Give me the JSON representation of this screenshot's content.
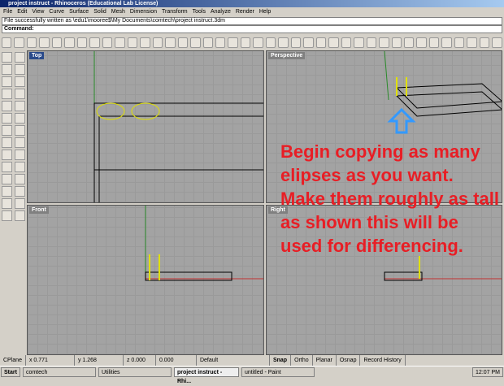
{
  "window": {
    "title": "project instruct - Rhinoceros (Educational Lab License)"
  },
  "menu": [
    "File",
    "Edit",
    "View",
    "Curve",
    "Surface",
    "Solid",
    "Mesh",
    "Dimension",
    "Transform",
    "Tools",
    "Analyze",
    "Render",
    "Help"
  ],
  "command_history": "File successfully written as \\edu1\\mooree$\\My Documents\\comtech\\project instruct.3dm",
  "command_prompt": "Command:",
  "viewports": [
    "Top",
    "Perspective",
    "Front",
    "Right"
  ],
  "annotation": "Begin copying as many elipses as you want.  Make them roughly as tall as shown this will be used for differencing.",
  "status": {
    "cplane": "CPlane",
    "x": "x 0.771",
    "y": "y 1.268",
    "z": "z 0.000",
    "d": "0.000",
    "layer": "Default",
    "toggles": [
      "Snap",
      "Ortho",
      "Planar",
      "Osnap",
      "Record History"
    ]
  },
  "taskbar": {
    "start": "Start",
    "items": [
      "comtech",
      "Utilities",
      "project instruct - Rhi...",
      "untitled - Paint"
    ],
    "clock": "12:07 PM"
  },
  "colors": {
    "annotation": "#e81e25",
    "viewport_bg": "#a3a3a3",
    "ellipse": "#e0e000"
  }
}
